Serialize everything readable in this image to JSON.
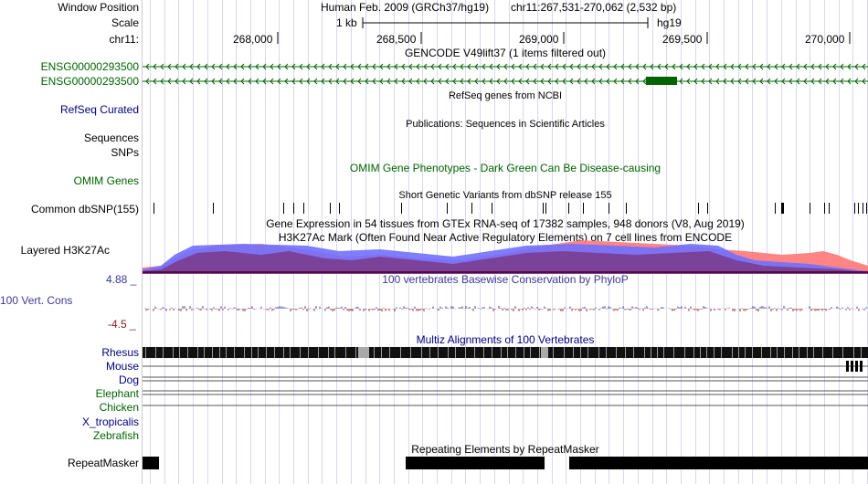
{
  "header": {
    "window_position_label": "Window Position",
    "scale_label": "Scale",
    "chrom_label": "chr11:",
    "assembly_title": "Human Feb. 2009 (GRCh37/hg19)",
    "position": "chr11:267,531-270,062 (2,532 bp)",
    "scale_value": "1 kb",
    "assembly": "hg19",
    "ticks": [
      "268,000",
      "268,500",
      "269,000",
      "269,500",
      "270,000"
    ]
  },
  "tracks": {
    "gencode": {
      "title": "GENCODE V49lift37 (1 items filtered out)",
      "items": [
        "ENSG00000293500",
        "ENSG00000293500"
      ],
      "color": "#006400"
    },
    "refseq": {
      "title": "RefSeq genes from NCBI",
      "label": "RefSeq Curated"
    },
    "publications": {
      "title": "Publications: Sequences in Scientific Articles",
      "label_1": "Sequences",
      "label_2": "SNPs"
    },
    "omim": {
      "title": "OMIM Gene Phenotypes - Dark Green Can Be Disease-causing",
      "label": "OMIM Genes"
    },
    "dbsnp": {
      "title": "Short Genetic Variants from dbSNP release 155",
      "label": "Common dbSNP(155)"
    },
    "gtex": {
      "title": "Gene Expression in 54 tissues from GTEx RNA-seq of 17382 samples, 948 donors (V8, Aug 2019)"
    },
    "h3k27ac": {
      "title": "H3K27Ac Mark (Often Found Near Active Regulatory Elements) on 7 cell lines from ENCODE",
      "label": "Layered H3K27Ac"
    },
    "phylop": {
      "title": "100 vertebrates Basewise Conservation by PhyloP",
      "label": "100 Vert. Cons",
      "max": "4.88 _",
      "min": "-4.5 _"
    },
    "multiz": {
      "title": "Multiz Alignments of 100 Vertebrates",
      "species": [
        "Rhesus",
        "Mouse",
        "Dog",
        "Elephant",
        "Chicken",
        "X_tropicalis",
        "Zebrafish"
      ]
    },
    "repeatmasker": {
      "title": "Repeating Elements by RepeatMasker",
      "label": "RepeatMasker"
    }
  },
  "colors": {
    "grid": "#d8d8f0",
    "gene_green": "#006400",
    "phylop_label": "#3a3a9a",
    "phylop_min": "#8b1a1a",
    "h3k27ac_blue": "#7070ff",
    "h3k27ac_red": "#ff7070",
    "h3k27ac_purple": "#7a3a8a"
  }
}
